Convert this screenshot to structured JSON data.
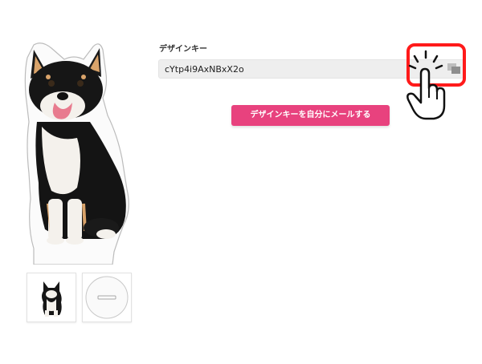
{
  "design_key": {
    "label": "デザインキー",
    "value": "cYtp4i9AxNBxX2o",
    "copy_icon": "copy-icon"
  },
  "email_button": {
    "label": "デザインキーを自分にメールする"
  },
  "preview": {
    "product_icon": "dog-cutout",
    "thumbnails": [
      "dog-thumbnail",
      "stand-base-thumbnail"
    ]
  },
  "annotation": {
    "highlight_color": "#ff1a1a",
    "pointer_icon": "hand-pointer-icon"
  },
  "colors": {
    "accent": "#e8427e",
    "field_bg": "#eeeeee"
  }
}
